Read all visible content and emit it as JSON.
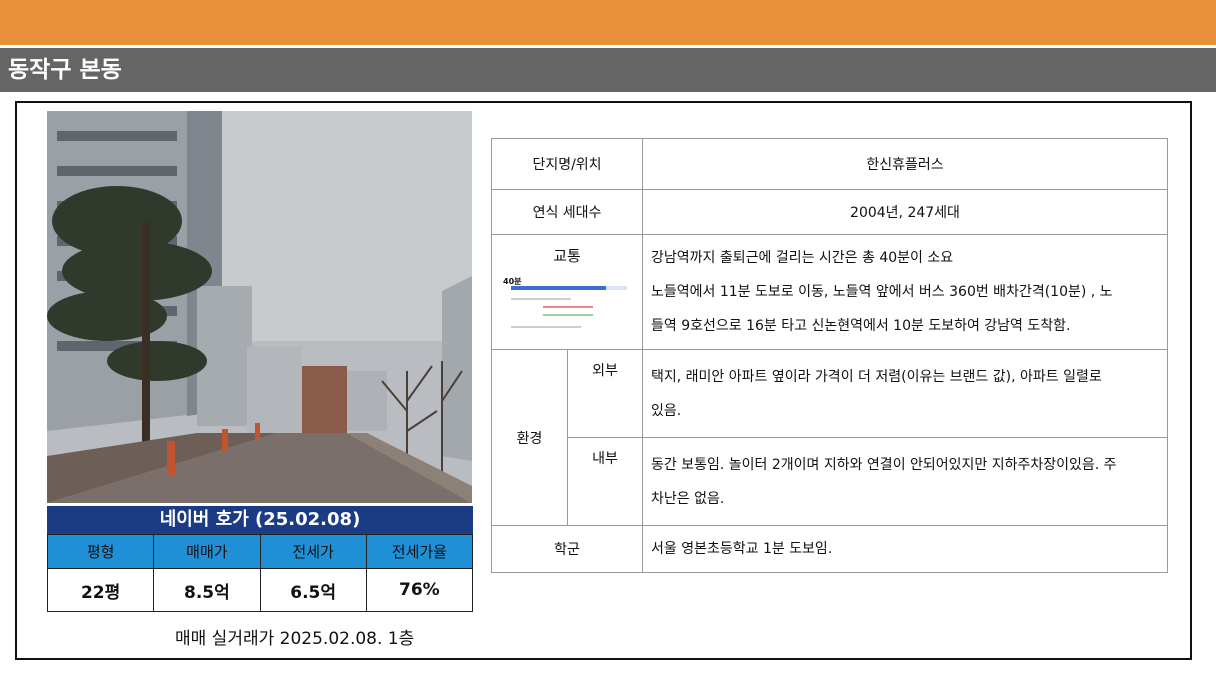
{
  "section_title": "동작구 본동",
  "photo": {
    "icon": "apartment-street-photo"
  },
  "price": {
    "title": "네이버 호가 (25.02.08)",
    "headers": [
      "평형",
      "매매가",
      "전세가",
      "전세가율"
    ],
    "values": [
      "22평",
      "8.5억",
      "6.5억",
      "76%"
    ]
  },
  "caption": "매매 실거래가 2025.02.08. 1층",
  "info": {
    "name_label": "단지명/위치",
    "name_value": "한신휴플러스",
    "year_label": "연식 세대수",
    "year_value": "2004년, 247세대",
    "transport_label": "교통",
    "transport_mini": "40분",
    "transport_lines": [
      "강남역까지 출퇴근에 걸리는 시간은 총 40분이 소요",
      "노들역에서 11분 도보로 이동, 노들역 앞에서 버스 360번 배차간격(10분) , 노",
      "들역 9호선으로 16분 타고 신논현역에서 10분 도보하여 강남역 도착함."
    ],
    "env_label": "환경",
    "outer_label": "외부",
    "outer_lines": [
      "택지, 래미안 아파트 옆이라 가격이 더 저렴(이유는 브랜드 값), 아파트 일렬로",
      "있음."
    ],
    "inner_label": "내부",
    "inner_lines": [
      "동간 보통임. 놀이터 2개이며 지하와 연결이 안되어있지만 지하주차장이있음. 주",
      "차난은 없음."
    ],
    "school_label": "학군",
    "school_value": "서울 영본초등학교 1분 도보임."
  }
}
